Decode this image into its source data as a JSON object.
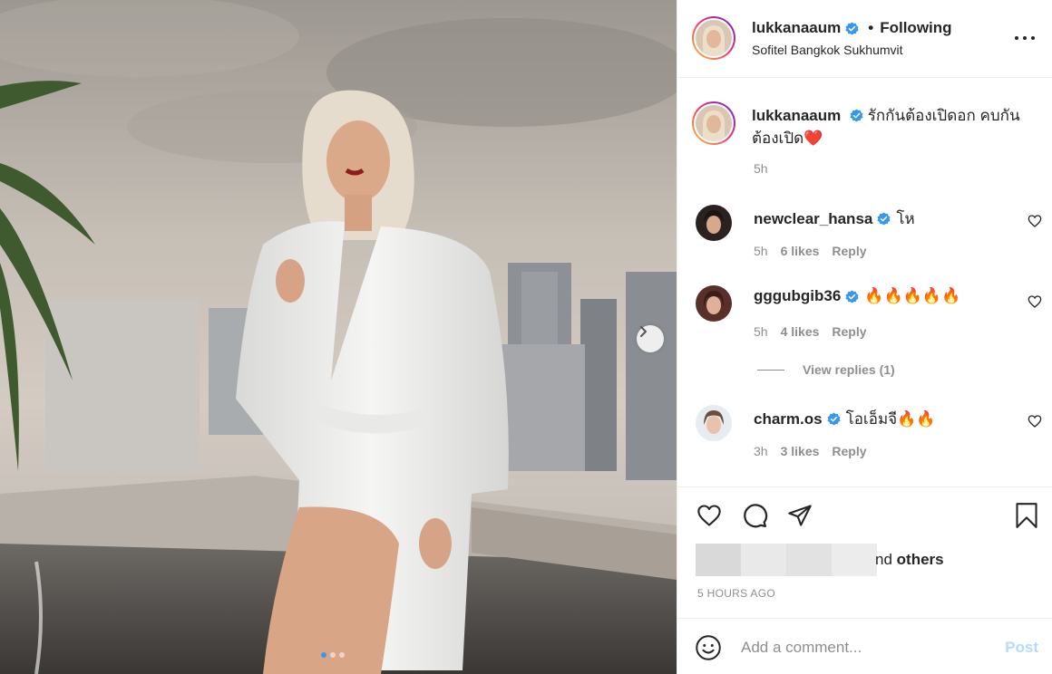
{
  "header": {
    "username": "lukkanaaum",
    "separator": "•",
    "follow_status": "Following",
    "location": "Sofitel Bangkok Sukhumvit",
    "more_icon": "more-horizontal-icon"
  },
  "caption": {
    "username": "lukkanaaum",
    "text": "รักกันต้องเปิดอก คบกันต้องเปิด❤️",
    "time": "5h"
  },
  "comments": [
    {
      "username": "newclear_hansa",
      "text": "โห",
      "time": "5h",
      "likes": "6 likes",
      "reply": "Reply"
    },
    {
      "username": "gggubgib36",
      "text": "🔥🔥🔥🔥🔥",
      "time": "5h",
      "likes": "4 likes",
      "reply": "Reply"
    },
    {
      "username": "charm.os",
      "text": "โอเอ็มจี🔥🔥",
      "time": "3h",
      "likes": "3 likes",
      "reply": "Reply"
    }
  ],
  "view_replies": "View replies (1)",
  "likes": {
    "tail": "nd",
    "others": "others"
  },
  "post_time": "5 HOURS AGO",
  "add_comment": {
    "placeholder": "Add a comment...",
    "post_label": "Post"
  },
  "carousel": {
    "slide_count": 3,
    "active_index": 0
  },
  "colors": {
    "verified": "#3897f0",
    "link_blue": "#b3dbff",
    "muted": "#8e8e8e",
    "text": "#262626"
  }
}
